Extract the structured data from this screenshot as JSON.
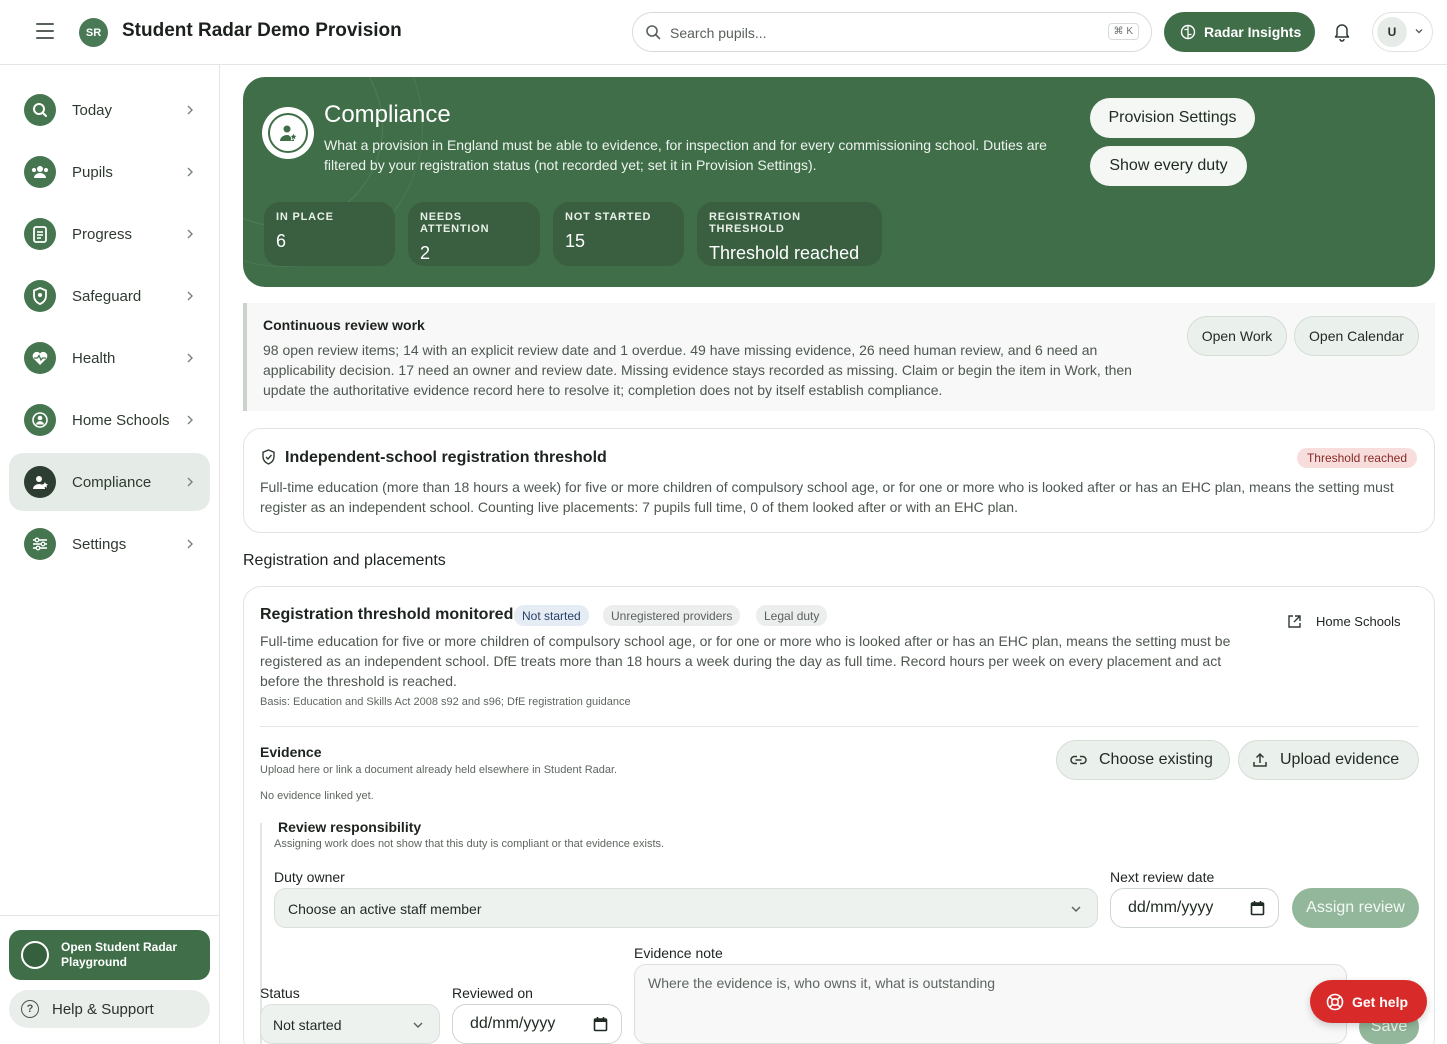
{
  "header": {
    "app_title": "Student Radar Demo Provision",
    "logo_text": "SR",
    "search_placeholder": "Search pupils...",
    "search_shortcut": "⌘ K",
    "insights_label": "Radar Insights",
    "user_initial": "U"
  },
  "sidebar": {
    "items": [
      {
        "label": "Today",
        "icon": "search-icon"
      },
      {
        "label": "Pupils",
        "icon": "people-icon"
      },
      {
        "label": "Progress",
        "icon": "clipboard-icon"
      },
      {
        "label": "Safeguard",
        "icon": "shield-icon"
      },
      {
        "label": "Health",
        "icon": "heart-pulse-icon"
      },
      {
        "label": "Home Schools",
        "icon": "user-circle-icon"
      },
      {
        "label": "Compliance",
        "icon": "user-star-icon",
        "active": true
      },
      {
        "label": "Settings",
        "icon": "sliders-icon"
      }
    ],
    "playground_label": "Open Student Radar Playground",
    "help_label": "Help & Support"
  },
  "hero": {
    "title": "Compliance",
    "description": "What a provision in England must be able to evidence, for inspection and for every commissioning school. Duties are filtered by your registration status (not recorded yet; set it in Provision Settings).",
    "buttons": {
      "settings": "Provision Settings",
      "show_all": "Show every duty"
    },
    "stats": [
      {
        "label": "IN PLACE",
        "value": "6"
      },
      {
        "label": "NEEDS ATTENTION",
        "value": "2"
      },
      {
        "label": "NOT STARTED",
        "value": "15"
      },
      {
        "label": "REGISTRATION THRESHOLD",
        "value": "Threshold reached"
      }
    ]
  },
  "review_work": {
    "title": "Continuous review work",
    "text": "98 open review items; 14 with an explicit review date and 1 overdue. 49 have missing evidence, 26 need human review, and 6 need an applicability decision. 17 need an owner and review date. Missing evidence stays recorded as missing. Claim or begin the item in Work, then update the authoritative evidence record here to resolve it; completion does not by itself establish compliance.",
    "open_work": "Open Work",
    "open_calendar": "Open Calendar"
  },
  "threshold": {
    "title": "Independent-school registration threshold",
    "badge": "Threshold reached",
    "text": "Full-time education (more than 18 hours a week) for five or more children of compulsory school age, or for one or more who is looked after or has an EHC plan, means the setting must register as an independent school. Counting live placements: 7 pupils full time, 0 of them looked after or with an EHC plan."
  },
  "section_heading": "Registration and placements",
  "duty": {
    "title": "Registration threshold monitored",
    "tags": [
      "Not started",
      "Unregistered providers",
      "Legal duty"
    ],
    "link": "Home Schools",
    "text": "Full-time education for five or more children of compulsory school age, or for one or more who is looked after or has an EHC plan, means the setting must be registered as an independent school. DfE treats more than 18 hours a week during the day as full time. Record hours per week on every placement and act before the threshold is reached.",
    "basis": "Basis: Education and Skills Act 2008 s92 and s96; DfE registration guidance",
    "evidence": {
      "title": "Evidence",
      "subtitle": "Upload here or link a document already held elsewhere in Student Radar.",
      "none": "No evidence linked yet.",
      "choose": "Choose existing",
      "upload": "Upload evidence"
    },
    "responsibility": {
      "title": "Review responsibility",
      "subtitle": "Assigning work does not show that this duty is compliant or that evidence exists.",
      "owner_label": "Duty owner",
      "owner_value": "Choose an active staff member",
      "review_date_label": "Next review date",
      "date_placeholder": "dd/mm/yyyy",
      "assign": "Assign review"
    },
    "status": {
      "label": "Status",
      "value": "Not started",
      "reviewed_label": "Reviewed on",
      "reviewed_placeholder": "dd/mm/yyyy",
      "note_label": "Evidence note",
      "note_placeholder": "Where the evidence is, who owns it, what is outstanding",
      "save": "Save"
    }
  },
  "get_help": "Get help",
  "colors": {
    "brand_green": "#3f6e48",
    "danger": "#d92a2a",
    "badge_red_bg": "#f7dedd"
  }
}
